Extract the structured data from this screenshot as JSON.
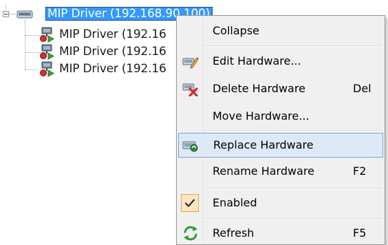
{
  "tree": {
    "root": {
      "label": "MIP Driver (192.168.90.100)",
      "icon": "driver-device-icon",
      "selected": true,
      "expanded": true
    },
    "children": [
      {
        "label": "MIP Driver (192.16",
        "icon": "hardware-camera-icon"
      },
      {
        "label": "MIP Driver (192.16",
        "icon": "hardware-camera-icon"
      },
      {
        "label": "MIP Driver (192.16",
        "icon": "hardware-camera-icon"
      }
    ]
  },
  "context_menu": {
    "items": [
      {
        "label": "Collapse",
        "shortcut": "",
        "icon": ""
      },
      {
        "label": "Edit Hardware...",
        "shortcut": "",
        "icon": "edit-hardware-icon"
      },
      {
        "label": "Delete Hardware",
        "shortcut": "Del",
        "icon": "delete-hardware-icon"
      },
      {
        "label": "Move Hardware...",
        "shortcut": "",
        "icon": ""
      },
      {
        "label": "Replace Hardware",
        "shortcut": "",
        "icon": "replace-hardware-icon",
        "hovered": true
      },
      {
        "label": "Rename Hardware",
        "shortcut": "F2",
        "icon": ""
      },
      {
        "label": "Enabled",
        "shortcut": "",
        "icon": "checkmark-icon",
        "checked": true
      },
      {
        "label": "Refresh",
        "shortcut": "F5",
        "icon": "refresh-icon"
      }
    ]
  },
  "colors": {
    "selection": "#3399ff",
    "menu_background": "#f0f0f0",
    "hover_background": "#dde9f7",
    "hover_border": "#7da2ce",
    "checked_background": "#fbe5c2",
    "checked_border": "#e1a64a"
  }
}
